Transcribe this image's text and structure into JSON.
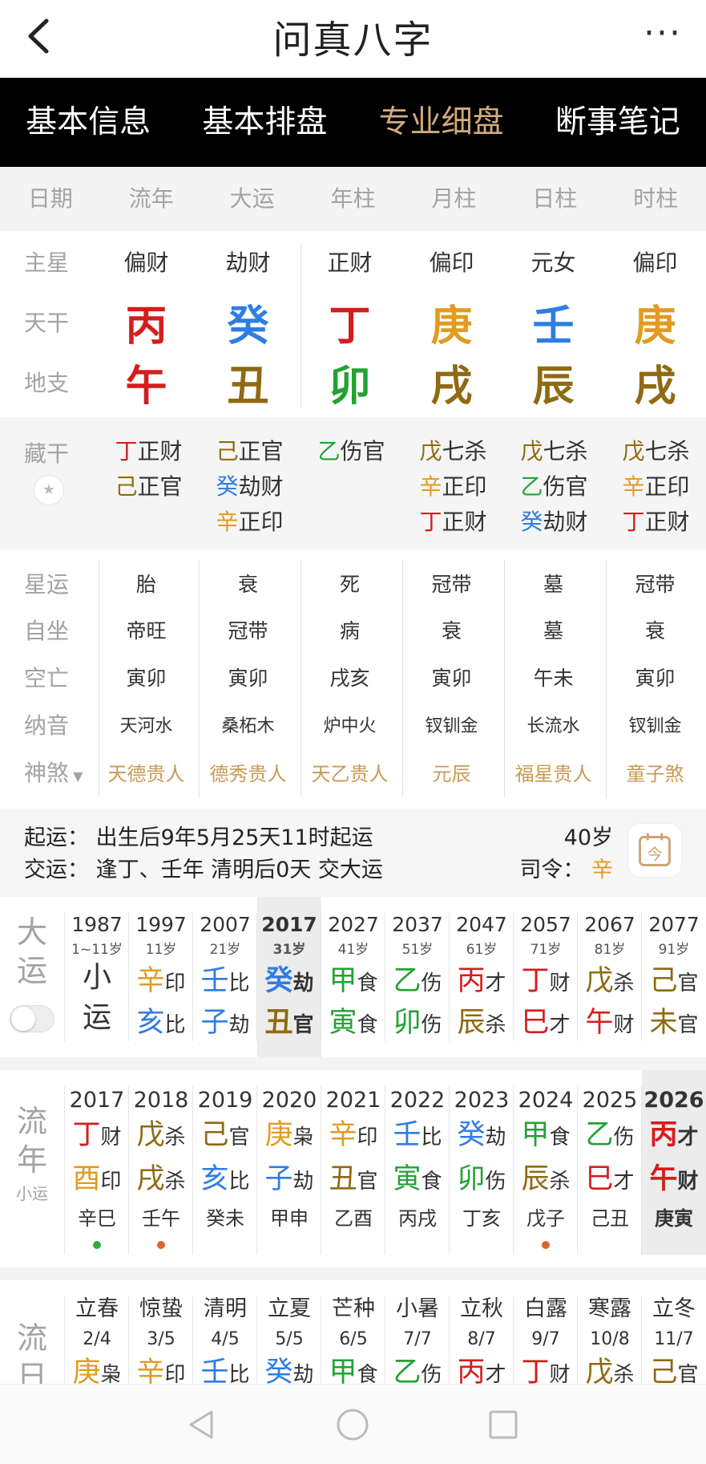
{
  "header": {
    "title": "问真八字",
    "back_icon": "chevron-left-icon",
    "more_icon": "more-icon",
    "more_text": "···"
  },
  "tabs": [
    {
      "label": "基本信息"
    },
    {
      "label": "基本排盘"
    },
    {
      "label": "专业细盘",
      "active": true
    },
    {
      "label": "断事笔记"
    }
  ],
  "columns": [
    "日期",
    "流年",
    "大运",
    "年柱",
    "月柱",
    "日柱",
    "时柱"
  ],
  "labels": {
    "zhuxing": "主星",
    "tiangan": "天干",
    "dizhi": "地支",
    "canggan": "藏干",
    "xingyun": "星运",
    "zizuo": "自坐",
    "kongwang": "空亡",
    "nayin": "纳音",
    "shensha": "神煞"
  },
  "colors": {
    "fire": "#d51d1d",
    "water": "#2f7de1",
    "wood": "#23a233",
    "metal": "#e29b1e",
    "earth": "#8f6a12",
    "accent": "#d2ab7b"
  },
  "zhuxing": [
    "偏财",
    "劫财",
    "正财",
    "偏印",
    "元女",
    "偏印"
  ],
  "tiangan": [
    {
      "ch": "丙",
      "c": "fire"
    },
    {
      "ch": "癸",
      "c": "water"
    },
    {
      "ch": "丁",
      "c": "fire"
    },
    {
      "ch": "庚",
      "c": "metal"
    },
    {
      "ch": "壬",
      "c": "water"
    },
    {
      "ch": "庚",
      "c": "metal"
    }
  ],
  "dizhi": [
    {
      "ch": "午",
      "c": "fire"
    },
    {
      "ch": "丑",
      "c": "earth"
    },
    {
      "ch": "卯",
      "c": "wood"
    },
    {
      "ch": "戌",
      "c": "earth"
    },
    {
      "ch": "辰",
      "c": "earth"
    },
    {
      "ch": "戌",
      "c": "earth"
    }
  ],
  "canggan": [
    [
      {
        "g": "丁",
        "c": "fire",
        "t": "正财"
      },
      {
        "g": "己",
        "c": "earth",
        "t": "正官"
      }
    ],
    [
      {
        "g": "己",
        "c": "earth",
        "t": "正官"
      },
      {
        "g": "癸",
        "c": "water",
        "t": "劫财"
      },
      {
        "g": "辛",
        "c": "metal",
        "t": "正印"
      }
    ],
    [
      {
        "g": "乙",
        "c": "wood",
        "t": "伤官"
      }
    ],
    [
      {
        "g": "戊",
        "c": "earth",
        "t": "七杀"
      },
      {
        "g": "辛",
        "c": "metal",
        "t": "正印"
      },
      {
        "g": "丁",
        "c": "fire",
        "t": "正财"
      }
    ],
    [
      {
        "g": "戊",
        "c": "earth",
        "t": "七杀"
      },
      {
        "g": "乙",
        "c": "wood",
        "t": "伤官"
      },
      {
        "g": "癸",
        "c": "water",
        "t": "劫财"
      }
    ],
    [
      {
        "g": "戊",
        "c": "earth",
        "t": "七杀"
      },
      {
        "g": "辛",
        "c": "metal",
        "t": "正印"
      },
      {
        "g": "丁",
        "c": "fire",
        "t": "正财"
      }
    ]
  ],
  "xingyun": [
    "胎",
    "衰",
    "死",
    "冠带",
    "墓",
    "冠带"
  ],
  "zizuo": [
    "帝旺",
    "冠带",
    "病",
    "衰",
    "墓",
    "衰"
  ],
  "kongwang": [
    "寅卯",
    "寅卯",
    "戌亥",
    "寅卯",
    "午未",
    "寅卯"
  ],
  "nayin": [
    "天河水",
    "桑柘木",
    "炉中火",
    "钗钏金",
    "长流水",
    "钗钏金"
  ],
  "shensha": [
    "天德贵人",
    "德秀贵人",
    "天乙贵人",
    "元辰",
    "福星贵人",
    "童子煞"
  ],
  "info": {
    "qiyun": "起运：  出生后9年5月25天11时起运",
    "jiaoyun": "交运：  逢丁、壬年 清明后0天 交大运",
    "age": "40岁",
    "siling_label": "司令：",
    "siling": "辛",
    "calendar_icon": "calendar-today-icon",
    "calendar_text": "今"
  },
  "dayun": {
    "label1": "大",
    "label2": "运",
    "items": [
      {
        "year": "1987",
        "age": "1~11岁",
        "xiao": [
          "小",
          "运"
        ]
      },
      {
        "year": "1997",
        "age": "11岁",
        "g": "辛",
        "gc": "metal",
        "gs": "印",
        "z": "亥",
        "zc": "water",
        "zs": "比"
      },
      {
        "year": "2007",
        "age": "21岁",
        "g": "壬",
        "gc": "water",
        "gs": "比",
        "z": "子",
        "zc": "water",
        "zs": "劫"
      },
      {
        "year": "2017",
        "age": "31岁",
        "g": "癸",
        "gc": "water",
        "gs": "劫",
        "z": "丑",
        "zc": "earth",
        "zs": "官",
        "sel": true
      },
      {
        "year": "2027",
        "age": "41岁",
        "g": "甲",
        "gc": "wood",
        "gs": "食",
        "z": "寅",
        "zc": "wood",
        "zs": "食"
      },
      {
        "year": "2037",
        "age": "51岁",
        "g": "乙",
        "gc": "wood",
        "gs": "伤",
        "z": "卯",
        "zc": "wood",
        "zs": "伤"
      },
      {
        "year": "2047",
        "age": "61岁",
        "g": "丙",
        "gc": "fire",
        "gs": "才",
        "z": "辰",
        "zc": "earth",
        "zs": "杀"
      },
      {
        "year": "2057",
        "age": "71岁",
        "g": "丁",
        "gc": "fire",
        "gs": "财",
        "z": "巳",
        "zc": "fire",
        "zs": "才"
      },
      {
        "year": "2067",
        "age": "81岁",
        "g": "戊",
        "gc": "earth",
        "gs": "杀",
        "z": "午",
        "zc": "fire",
        "zs": "财"
      },
      {
        "year": "2077",
        "age": "91岁",
        "g": "己",
        "gc": "earth",
        "gs": "官",
        "z": "未",
        "zc": "earth",
        "zs": "官"
      }
    ]
  },
  "liunian": {
    "label1": "流",
    "label2": "年",
    "sub": "小运",
    "items": [
      {
        "year": "2017",
        "g": "丁",
        "gc": "fire",
        "gs": "财",
        "z": "酉",
        "zc": "metal",
        "zs": "印",
        "xy": "辛巳",
        "dot": "#2fae3c"
      },
      {
        "year": "2018",
        "g": "戊",
        "gc": "earth",
        "gs": "杀",
        "z": "戌",
        "zc": "earth",
        "zs": "杀",
        "xy": "壬午",
        "dot": "#e0632c"
      },
      {
        "year": "2019",
        "g": "己",
        "gc": "earth",
        "gs": "官",
        "z": "亥",
        "zc": "water",
        "zs": "比",
        "xy": "癸未"
      },
      {
        "year": "2020",
        "g": "庚",
        "gc": "metal",
        "gs": "枭",
        "z": "子",
        "zc": "water",
        "zs": "劫",
        "xy": "甲申"
      },
      {
        "year": "2021",
        "g": "辛",
        "gc": "metal",
        "gs": "印",
        "z": "丑",
        "zc": "earth",
        "zs": "官",
        "xy": "乙酉"
      },
      {
        "year": "2022",
        "g": "壬",
        "gc": "water",
        "gs": "比",
        "z": "寅",
        "zc": "wood",
        "zs": "食",
        "xy": "丙戌"
      },
      {
        "year": "2023",
        "g": "癸",
        "gc": "water",
        "gs": "劫",
        "z": "卯",
        "zc": "wood",
        "zs": "伤",
        "xy": "丁亥"
      },
      {
        "year": "2024",
        "g": "甲",
        "gc": "wood",
        "gs": "食",
        "z": "辰",
        "zc": "earth",
        "zs": "杀",
        "xy": "戊子",
        "dot": "#e0632c"
      },
      {
        "year": "2025",
        "g": "乙",
        "gc": "wood",
        "gs": "伤",
        "z": "巳",
        "zc": "fire",
        "zs": "才",
        "xy": "己丑"
      },
      {
        "year": "2026",
        "g": "丙",
        "gc": "fire",
        "gs": "才",
        "z": "午",
        "zc": "fire",
        "zs": "财",
        "xy": "庚寅",
        "sel": true
      }
    ]
  },
  "liuyue": {
    "label1": "流",
    "label2": "日",
    "items": [
      {
        "jq": "立春",
        "d": "2/4",
        "g": "庚",
        "gc": "metal",
        "gs": "枭"
      },
      {
        "jq": "惊蛰",
        "d": "3/5",
        "g": "辛",
        "gc": "metal",
        "gs": "印"
      },
      {
        "jq": "清明",
        "d": "4/5",
        "g": "壬",
        "gc": "water",
        "gs": "比"
      },
      {
        "jq": "立夏",
        "d": "5/5",
        "g": "癸",
        "gc": "water",
        "gs": "劫"
      },
      {
        "jq": "芒种",
        "d": "6/5",
        "g": "甲",
        "gc": "wood",
        "gs": "食"
      },
      {
        "jq": "小暑",
        "d": "7/7",
        "g": "乙",
        "gc": "wood",
        "gs": "伤"
      },
      {
        "jq": "立秋",
        "d": "8/7",
        "g": "丙",
        "gc": "fire",
        "gs": "才"
      },
      {
        "jq": "白露",
        "d": "9/7",
        "g": "丁",
        "gc": "fire",
        "gs": "财"
      },
      {
        "jq": "寒露",
        "d": "10/8",
        "g": "戊",
        "gc": "earth",
        "gs": "杀"
      },
      {
        "jq": "立冬",
        "d": "11/7",
        "g": "己",
        "gc": "earth",
        "gs": "官"
      }
    ]
  },
  "navbar": {
    "back_icon": "nav-back-icon",
    "home_icon": "nav-home-icon",
    "recent_icon": "nav-recent-icon"
  }
}
